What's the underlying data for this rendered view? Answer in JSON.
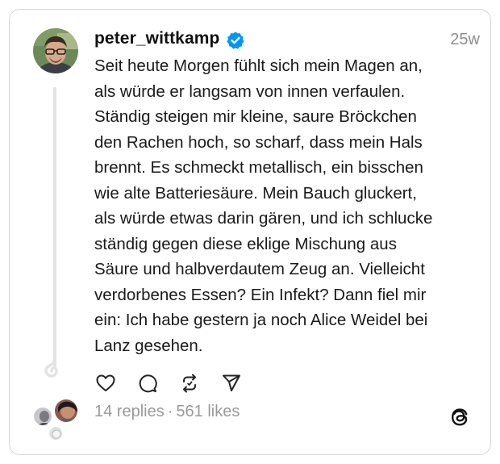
{
  "post": {
    "username": "peter_wittkamp",
    "time": "25w",
    "text": "Seit heute Morgen fühlt sich mein Magen an,\nals würde er langsam von innen verfaulen.\nStändig steigen mir kleine, saure Bröckchen\nden Rachen hoch, so scharf, dass mein Hals\nbrennt. Es schmeckt metallisch, ein bisschen\nwie alte Batteriesäure. Mein Bauch gluckert,\nals würde etwas darin gären, und ich schlucke\nständig gegen diese eklige Mischung aus\nSäure und halbverdautem Zeug an. Vielleicht\nverdorbenes Essen? Ein Infekt? Dann fiel mir\nein: Ich habe gestern ja noch Alice Weidel bei\nLanz gesehen."
  },
  "stats": {
    "replies": "14 replies",
    "separator": "·",
    "likes": "561 likes"
  },
  "icons": {
    "verified": "verified-badge-icon",
    "like": "heart-icon",
    "reply": "comment-icon",
    "repost": "repost-icon",
    "share": "send-icon",
    "brand": "threads-logo-icon"
  },
  "colors": {
    "verified": "#0095f6",
    "muted": "#999999",
    "border": "#d4d4d4"
  }
}
